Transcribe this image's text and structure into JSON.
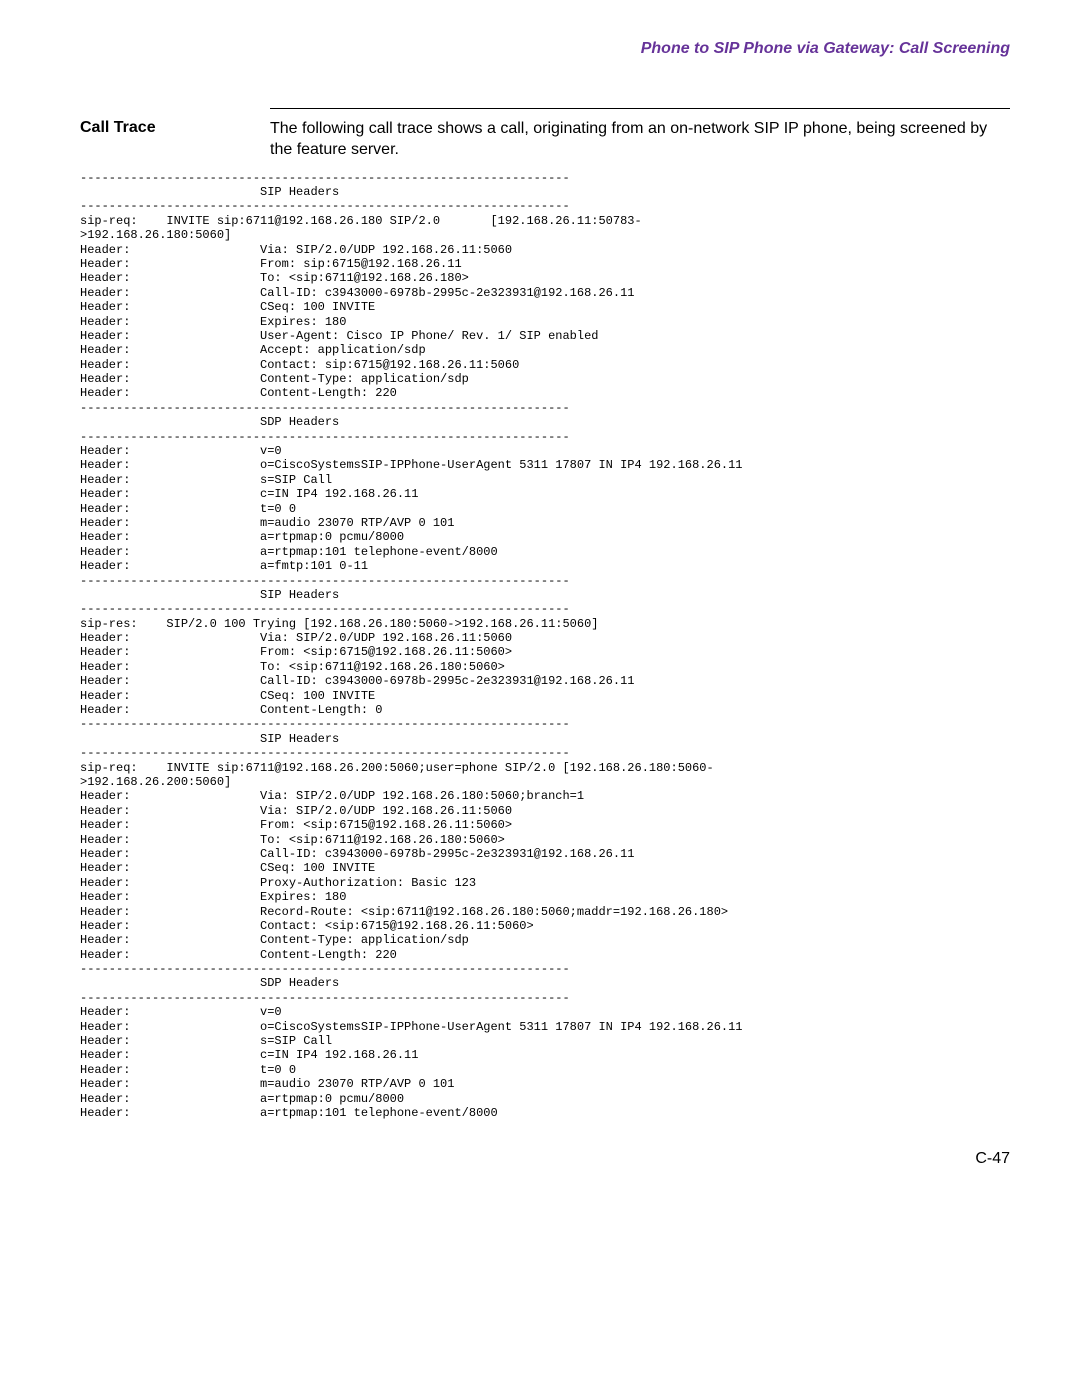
{
  "header": {
    "title": "Phone to SIP Phone via Gateway: Call Screening"
  },
  "section": {
    "label": "Call Trace",
    "text": "The following call trace shows a call, originating from an on-network SIP IP phone, being screened by the feature server."
  },
  "trace": "--------------------------------------------------------------------\n                         SIP Headers\n--------------------------------------------------------------------\nsip-req:    INVITE sip:6711@192.168.26.180 SIP/2.0       [192.168.26.11:50783-\n>192.168.26.180:5060]\nHeader:                  Via: SIP/2.0/UDP 192.168.26.11:5060\nHeader:                  From: sip:6715@192.168.26.11\nHeader:                  To: <sip:6711@192.168.26.180>\nHeader:                  Call-ID: c3943000-6978b-2995c-2e323931@192.168.26.11\nHeader:                  CSeq: 100 INVITE\nHeader:                  Expires: 180\nHeader:                  User-Agent: Cisco IP Phone/ Rev. 1/ SIP enabled\nHeader:                  Accept: application/sdp\nHeader:                  Contact: sip:6715@192.168.26.11:5060\nHeader:                  Content-Type: application/sdp\nHeader:                  Content-Length: 220\n--------------------------------------------------------------------\n                         SDP Headers\n--------------------------------------------------------------------\nHeader:                  v=0\nHeader:                  o=CiscoSystemsSIP-IPPhone-UserAgent 5311 17807 IN IP4 192.168.26.11\nHeader:                  s=SIP Call\nHeader:                  c=IN IP4 192.168.26.11\nHeader:                  t=0 0\nHeader:                  m=audio 23070 RTP/AVP 0 101\nHeader:                  a=rtpmap:0 pcmu/8000\nHeader:                  a=rtpmap:101 telephone-event/8000\nHeader:                  a=fmtp:101 0-11\n--------------------------------------------------------------------\n                         SIP Headers\n--------------------------------------------------------------------\nsip-res:    SIP/2.0 100 Trying [192.168.26.180:5060->192.168.26.11:5060]\nHeader:                  Via: SIP/2.0/UDP 192.168.26.11:5060\nHeader:                  From: <sip:6715@192.168.26.11:5060>\nHeader:                  To: <sip:6711@192.168.26.180:5060>\nHeader:                  Call-ID: c3943000-6978b-2995c-2e323931@192.168.26.11\nHeader:                  CSeq: 100 INVITE\nHeader:                  Content-Length: 0\n--------------------------------------------------------------------\n                         SIP Headers\n--------------------------------------------------------------------\nsip-req:    INVITE sip:6711@192.168.26.200:5060;user=phone SIP/2.0 [192.168.26.180:5060-\n>192.168.26.200:5060]\nHeader:                  Via: SIP/2.0/UDP 192.168.26.180:5060;branch=1\nHeader:                  Via: SIP/2.0/UDP 192.168.26.11:5060\nHeader:                  From: <sip:6715@192.168.26.11:5060>\nHeader:                  To: <sip:6711@192.168.26.180:5060>\nHeader:                  Call-ID: c3943000-6978b-2995c-2e323931@192.168.26.11\nHeader:                  CSeq: 100 INVITE\nHeader:                  Proxy-Authorization: Basic 123\nHeader:                  Expires: 180\nHeader:                  Record-Route: <sip:6711@192.168.26.180:5060;maddr=192.168.26.180>\nHeader:                  Contact: <sip:6715@192.168.26.11:5060>\nHeader:                  Content-Type: application/sdp\nHeader:                  Content-Length: 220\n--------------------------------------------------------------------\n                         SDP Headers\n--------------------------------------------------------------------\nHeader:                  v=0\nHeader:                  o=CiscoSystemsSIP-IPPhone-UserAgent 5311 17807 IN IP4 192.168.26.11\nHeader:                  s=SIP Call\nHeader:                  c=IN IP4 192.168.26.11\nHeader:                  t=0 0\nHeader:                  m=audio 23070 RTP/AVP 0 101\nHeader:                  a=rtpmap:0 pcmu/8000\nHeader:                  a=rtpmap:101 telephone-event/8000",
  "footer": {
    "page": "C-47"
  }
}
